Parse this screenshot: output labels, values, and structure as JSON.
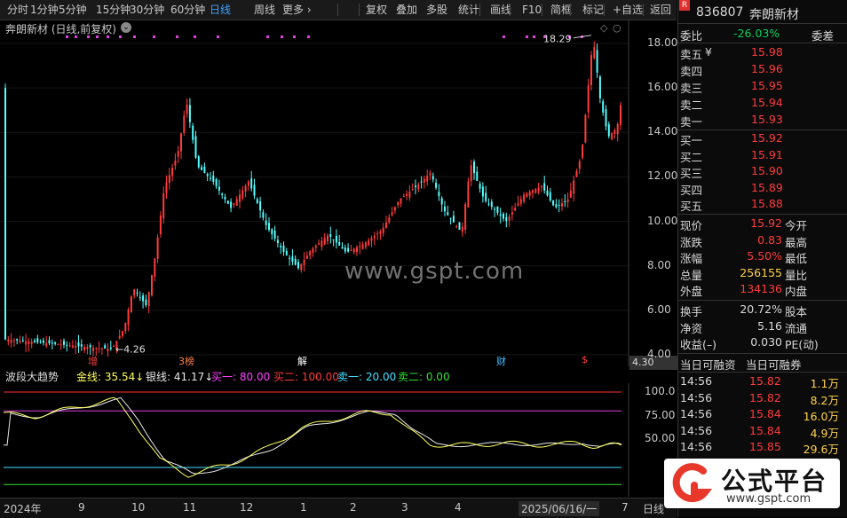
{
  "toolbar": {
    "periods": [
      "分时",
      "1分钟",
      "5分钟",
      "15分钟",
      "30分钟",
      "60分钟",
      "日线",
      "周线",
      "更多 ›"
    ],
    "active": "日线",
    "actions": [
      "复权",
      "叠加",
      "多股",
      "统计",
      "画线",
      "F10",
      "简框",
      "标记",
      "+自选",
      "返回"
    ]
  },
  "kchart": {
    "title": "奔朗新材 (日线,前复权)",
    "yticks": [
      "18.00",
      "16.00",
      "14.00",
      "12.00",
      "10.00",
      "8.00",
      "6.00",
      "4.00"
    ],
    "max_label": "18.29",
    "min_label": "4.26",
    "current_label": "4.30",
    "watermark": "www.gspt.com",
    "markers": [
      {
        "t": "增",
        "color": "#ff4040"
      },
      {
        "t": "3榜",
        "color": "#ff8040"
      },
      {
        "t": "解",
        "color": "#ffffff"
      },
      {
        "t": "财",
        "color": "#40c0ff"
      },
      {
        "t": "$",
        "color": "#ff4040"
      }
    ]
  },
  "indicator": {
    "name": "波段大趋势",
    "items": [
      {
        "label": "金线:",
        "value": "35.54",
        "arrow": "↓",
        "color": "#ffff60"
      },
      {
        "label": "银线:",
        "value": "41.17",
        "arrow": "↓",
        "color": "#e8e8e8"
      },
      {
        "label": "买一:",
        "value": "80.00",
        "color": "#ff40ff"
      },
      {
        "label": "买二:",
        "value": "100.00",
        "color": "#ff3b3b"
      },
      {
        "label": "卖一:",
        "value": "20.00",
        "color": "#40e0ff"
      },
      {
        "label": "卖二:",
        "value": "0.00",
        "color": "#30e030"
      }
    ],
    "yticks": [
      "100.0",
      "75.00",
      "50.00"
    ]
  },
  "dates": [
    "2024年",
    "9",
    "10",
    "11",
    "12",
    "1",
    "2",
    "3",
    "4",
    "2025/06/16/一",
    "7",
    "日线"
  ],
  "stock": {
    "code": "836807",
    "name": "奔朗新材",
    "badge": "R",
    "webi_label": "委比",
    "webi": "-26.03%",
    "weicha_label": "委差",
    "sell": [
      {
        "l": "卖五",
        "p": "15.98",
        "flag": "¥"
      },
      {
        "l": "卖四",
        "p": "15.96"
      },
      {
        "l": "卖三",
        "p": "15.95"
      },
      {
        "l": "卖二",
        "p": "15.94"
      },
      {
        "l": "卖一",
        "p": "15.93"
      }
    ],
    "buy": [
      {
        "l": "买一",
        "p": "15.92"
      },
      {
        "l": "买二",
        "p": "15.91"
      },
      {
        "l": "买三",
        "p": "15.90"
      },
      {
        "l": "买四",
        "p": "15.89"
      },
      {
        "l": "买五",
        "p": "15.88"
      }
    ],
    "stats": [
      {
        "l": "现价",
        "v": "15.92",
        "c": "red",
        "r": "今开"
      },
      {
        "l": "涨跌",
        "v": "0.83",
        "c": "red",
        "r": "最高"
      },
      {
        "l": "涨幅",
        "v": "5.50%",
        "c": "red",
        "r": "最低"
      },
      {
        "l": "总量",
        "v": "256155",
        "c": "yel",
        "r": "量比"
      },
      {
        "l": "外盘",
        "v": "134136",
        "c": "red",
        "r": "内盘"
      }
    ],
    "stats2": [
      {
        "l": "换手",
        "v": "20.72%",
        "r": "股本"
      },
      {
        "l": "净资",
        "v": "5.16",
        "r": "流通"
      },
      {
        "l": "收益(–)",
        "v": "0.030",
        "r": "PE(动)"
      }
    ],
    "rz_header": [
      "当日可融资",
      "当日可融券"
    ],
    "ticks": [
      {
        "t": "14:56",
        "p": "15.82",
        "v": "1.1万"
      },
      {
        "t": "14:56",
        "p": "15.82",
        "v": "8.2万"
      },
      {
        "t": "14:56",
        "p": "15.84",
        "v": "16.0万"
      },
      {
        "t": "14:56",
        "p": "15.84",
        "v": "4.9万"
      },
      {
        "t": "14:56",
        "p": "15.85",
        "v": "29.6万"
      },
      {
        "t": "14:56",
        "p": "15.86",
        "v": "29.7万"
      }
    ]
  },
  "brand": {
    "name": "公式平台",
    "url": "www.gspt.com"
  }
}
